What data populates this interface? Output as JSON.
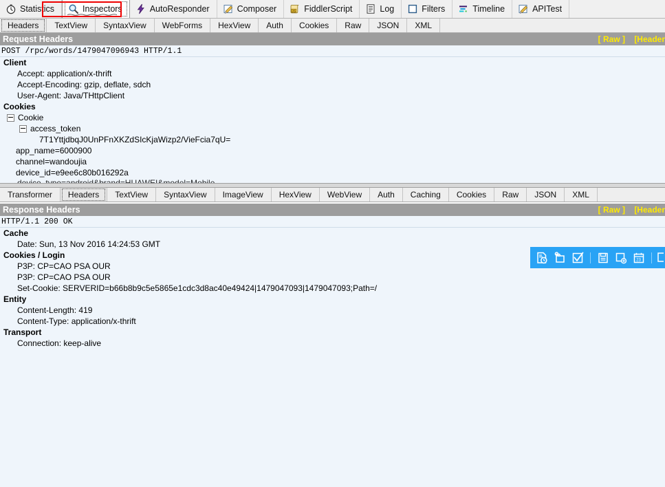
{
  "main_tabs": [
    {
      "label": "Statistics",
      "icon": "stopwatch-icon",
      "selected": false
    },
    {
      "label": "Inspectors",
      "icon": "magnifier-icon",
      "selected": true
    },
    {
      "label": "AutoResponder",
      "icon": "lightning-icon",
      "selected": false
    },
    {
      "label": "Composer",
      "icon": "pencil-note-icon",
      "selected": false
    },
    {
      "label": "FiddlerScript",
      "icon": "js-script-icon",
      "selected": false
    },
    {
      "label": "Log",
      "icon": "log-list-icon",
      "selected": false
    },
    {
      "label": "Filters",
      "icon": "filter-square-icon",
      "selected": false
    },
    {
      "label": "Timeline",
      "icon": "timeline-icon",
      "selected": false
    },
    {
      "label": "APITest",
      "icon": "pencil-note-icon",
      "selected": false
    }
  ],
  "request": {
    "tabs": [
      {
        "label": "Headers",
        "selected": true
      },
      {
        "label": "TextView",
        "selected": false
      },
      {
        "label": "SyntaxView",
        "selected": false
      },
      {
        "label": "WebForms",
        "selected": false
      },
      {
        "label": "HexView",
        "selected": false
      },
      {
        "label": "Auth",
        "selected": false
      },
      {
        "label": "Cookies",
        "selected": false
      },
      {
        "label": "Raw",
        "selected": false
      },
      {
        "label": "JSON",
        "selected": false
      },
      {
        "label": "XML",
        "selected": false
      }
    ],
    "section_title": "Request Headers",
    "raw_link": "[ Raw ]",
    "header_link": "[Header",
    "status_line": "POST /rpc/words/1479047096943 HTTP/1.1",
    "groups": [
      {
        "name": "Client",
        "items": [
          "Accept: application/x-thrift",
          "Accept-Encoding: gzip, deflate, sdch",
          "User-Agent: Java/THttpClient"
        ]
      },
      {
        "name": "Cookies",
        "tree": {
          "root": "Cookie",
          "child": "access_token",
          "child_value": "7T1YttjdbqJ0UnPFnXKZdSIcKjaWizp2/VieFcia7qU=",
          "siblings": [
            "app_name=6000900",
            "channel=wandoujia",
            "device_id=e9ee6c80b016292a"
          ],
          "clipped": "device_type=android&brand=HUAWEI&model=Mobile"
        }
      }
    ]
  },
  "response": {
    "tabs": [
      {
        "label": "Transformer",
        "selected": false
      },
      {
        "label": "Headers",
        "selected": true
      },
      {
        "label": "TextView",
        "selected": false
      },
      {
        "label": "SyntaxView",
        "selected": false
      },
      {
        "label": "ImageView",
        "selected": false
      },
      {
        "label": "HexView",
        "selected": false
      },
      {
        "label": "WebView",
        "selected": false
      },
      {
        "label": "Auth",
        "selected": false
      },
      {
        "label": "Caching",
        "selected": false
      },
      {
        "label": "Cookies",
        "selected": false
      },
      {
        "label": "Raw",
        "selected": false
      },
      {
        "label": "JSON",
        "selected": false
      },
      {
        "label": "XML",
        "selected": false
      }
    ],
    "section_title": "Response Headers",
    "raw_link": "[ Raw ]",
    "header_link": "[Header",
    "status_line": "HTTP/1.1 200 OK",
    "groups": [
      {
        "name": "Cache",
        "items": [
          "Date: Sun, 13 Nov 2016 14:24:53 GMT"
        ]
      },
      {
        "name": "Cookies / Login",
        "items": [
          "P3P: CP=CAO PSA OUR",
          "P3P: CP=CAO PSA OUR",
          "Set-Cookie: SERVERID=b66b8b9c5e5865e1cdc3d8ac40e49424|1479047093|1479047093;Path=/"
        ]
      },
      {
        "name": "Entity",
        "items": [
          "Content-Length: 419",
          "Content-Type: application/x-thrift"
        ]
      },
      {
        "name": "Transport",
        "items": [
          "Connection: keep-alive"
        ]
      }
    ]
  },
  "blue_toolbar": {
    "background": "#29a3f5",
    "buttons": [
      {
        "icon": "document-history-icon"
      },
      {
        "icon": "key-folder-icon"
      },
      {
        "icon": "checkbox-checked-icon"
      },
      {
        "icon": "save-floppy-icon"
      },
      {
        "icon": "page-add-icon"
      },
      {
        "icon": "calendar-23-icon"
      }
    ]
  },
  "annotation": {
    "highlight_color": "#ee0000",
    "highlight_target": "Inspectors"
  },
  "colors": {
    "section_bar": "#9d9d9d",
    "pane_background": "#eff5fb",
    "link_yellow": "#ffea00",
    "accent_blue": "#29a3f5"
  }
}
